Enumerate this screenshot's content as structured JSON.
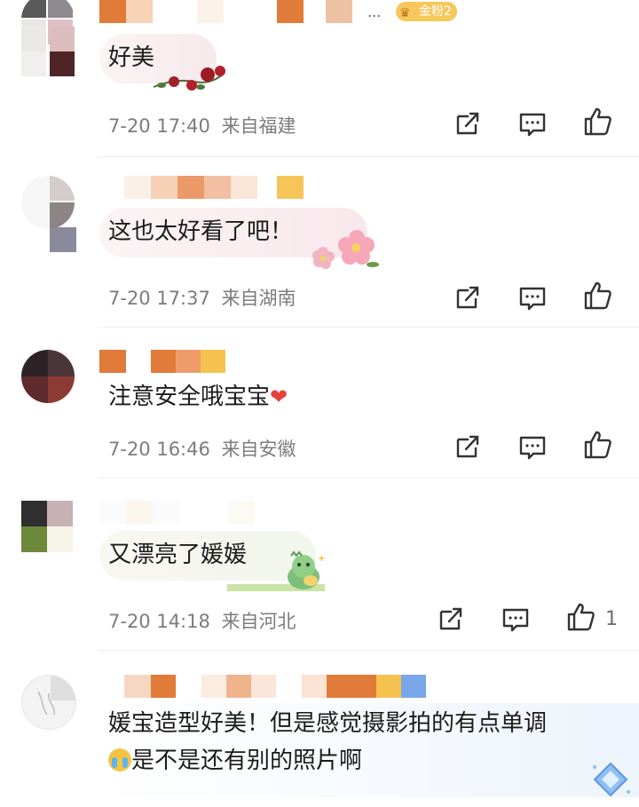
{
  "comments": [
    {
      "text": "好美",
      "time": "7-20 17:40",
      "location": "来自福建"
    },
    {
      "text": "这也太好看了吧！",
      "time": "7-20 17:37",
      "location": "来自湖南"
    },
    {
      "text": "注意安全哦宝宝",
      "time": "7-20 16:46",
      "location": "来自安徽"
    },
    {
      "text": "又漂亮了媛媛",
      "time": "7-20 14:18",
      "location": "来自河北",
      "like_count": "1"
    },
    {
      "text_line1": "媛宝造型好美！但是感觉摄影拍的有点单调",
      "text_line2": "是不是还有别的照片啊"
    }
  ],
  "badge": {
    "label": "金粉2",
    "ellipsis": "..."
  },
  "colors": {
    "accent": "#e07b39",
    "meta": "#7c7c7c",
    "heart": "#e8403a",
    "badge": "#f6c85c"
  },
  "icons": [
    "share-icon",
    "comment-icon",
    "like-icon",
    "heart-emoji-icon",
    "crying-emoji-icon",
    "rose-sticker",
    "flower-sticker",
    "dinosaur-sticker",
    "diamond-sticker"
  ]
}
